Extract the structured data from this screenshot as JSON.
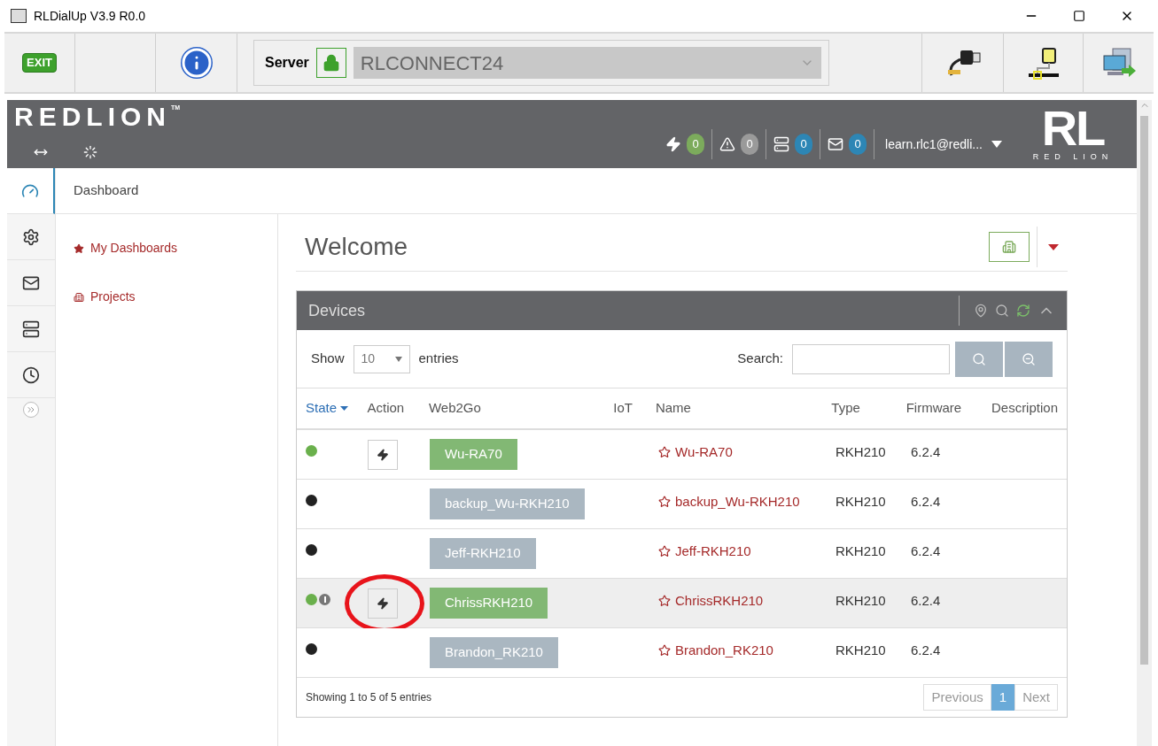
{
  "window": {
    "title": "RLDialUp V3.9 R0.0"
  },
  "toolbar": {
    "exit_label": "EXIT",
    "server_label": "Server",
    "server_value": "RLCONNECT24"
  },
  "header": {
    "brand": "REDLION",
    "brand_mark": "TM",
    "logo_letters": "RL",
    "logo_caption": "RED LION",
    "counters": [
      {
        "kind": "bolt",
        "count": "0",
        "color": "#7cab5c"
      },
      {
        "kind": "warning",
        "count": "0",
        "color": "#9a9a9a"
      },
      {
        "kind": "server",
        "count": "0",
        "color": "#2d86b5"
      },
      {
        "kind": "mail",
        "count": "0",
        "color": "#2d86b5"
      }
    ],
    "user": "learn.rlc1@redli..."
  },
  "sidebar": {
    "items": [
      {
        "kind": "dashboard",
        "selected": true
      },
      {
        "kind": "gears",
        "selected": false
      },
      {
        "kind": "mail",
        "selected": false
      },
      {
        "kind": "server",
        "selected": false
      },
      {
        "kind": "clock",
        "selected": false
      }
    ]
  },
  "breadcrumb": "Dashboard",
  "nav": [
    {
      "kind": "star",
      "label": "My Dashboards"
    },
    {
      "kind": "building",
      "label": "Projects"
    }
  ],
  "page_title": "Welcome",
  "devices": {
    "title": "Devices",
    "show_label": "Show",
    "page_size": "10",
    "entries_label": "entries",
    "search_label": "Search:",
    "columns": [
      {
        "label": "State",
        "sorted": true
      },
      {
        "label": "Action",
        "sorted": false
      },
      {
        "label": "Web2Go",
        "sorted": false
      },
      {
        "label": "IoT",
        "sorted": false
      },
      {
        "label": "Name",
        "sorted": false
      },
      {
        "label": "Type",
        "sorted": false
      },
      {
        "label": "Firmware",
        "sorted": false
      },
      {
        "label": "Description",
        "sorted": false
      }
    ],
    "rows": [
      {
        "online": true,
        "alert": false,
        "highlighted": false,
        "circled": false,
        "web2go": "Wu-RA70",
        "name": "Wu-RA70",
        "type": "RKH210",
        "firmware": "6.2.4"
      },
      {
        "online": false,
        "alert": false,
        "highlighted": false,
        "circled": false,
        "web2go": "backup_Wu-RKH210",
        "name": "backup_Wu-RKH210",
        "type": "RKH210",
        "firmware": "6.2.4"
      },
      {
        "online": false,
        "alert": false,
        "highlighted": false,
        "circled": false,
        "web2go": "Jeff-RKH210",
        "name": "Jeff-RKH210",
        "type": "RKH210",
        "firmware": "6.2.4"
      },
      {
        "online": true,
        "alert": true,
        "highlighted": true,
        "circled": true,
        "web2go": "ChrissRKH210",
        "name": "ChrissRKH210",
        "type": "RKH210",
        "firmware": "6.2.4"
      },
      {
        "online": false,
        "alert": false,
        "highlighted": false,
        "circled": false,
        "web2go": "Brandon_RK210",
        "name": "Brandon_RK210",
        "type": "RKH210",
        "firmware": "6.2.4"
      }
    ],
    "info": "Showing 1 to 5 of 5 entries",
    "pager": [
      {
        "label": "Previous",
        "selected": false
      },
      {
        "label": "1",
        "selected": true
      },
      {
        "label": "Next",
        "selected": false
      }
    ]
  }
}
